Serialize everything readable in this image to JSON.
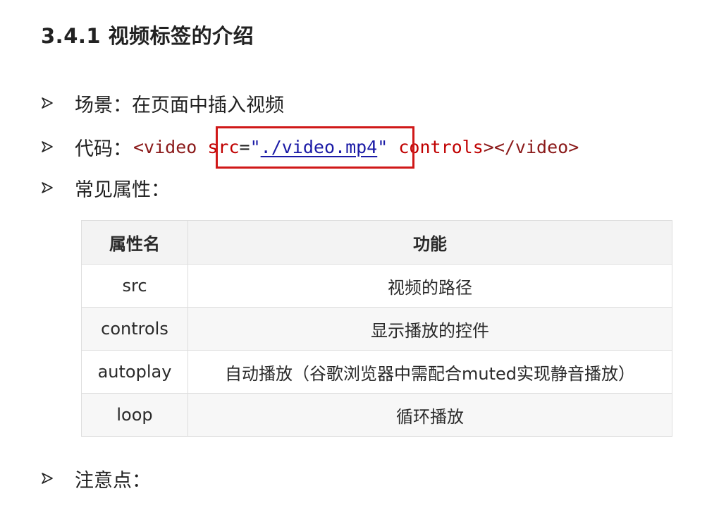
{
  "heading": "3.4.1 视频标签的介绍",
  "bullets": {
    "scene": "场景：在页面中插入视频",
    "code_label": "代码：",
    "attrs_label": "常见属性：",
    "notes_label": "注意点："
  },
  "code": {
    "open_tag": "<video",
    "space1": " ",
    "attr_src": "src",
    "eq": "=",
    "quote_open": "\"",
    "src_value": "./video.mp4",
    "quote_close": "\"",
    "space2": " ",
    "attr_controls": "controls",
    "close_tags": "></video>"
  },
  "table": {
    "headers": [
      "属性名",
      "功能"
    ],
    "rows": [
      {
        "name": "src",
        "desc": "视频的路径"
      },
      {
        "name": "controls",
        "desc": "显示播放的控件"
      },
      {
        "name": "autoplay",
        "desc": "自动播放（谷歌浏览器中需配合muted实现静音播放）"
      },
      {
        "name": "loop",
        "desc": "循环播放"
      }
    ]
  },
  "colors": {
    "highlight_border": "#d01818",
    "tag": "#8b1a1a",
    "attribute": "#c00000",
    "string": "#1a1aa6"
  },
  "icons": {
    "bullet": "arrowhead-bullet-icon"
  }
}
